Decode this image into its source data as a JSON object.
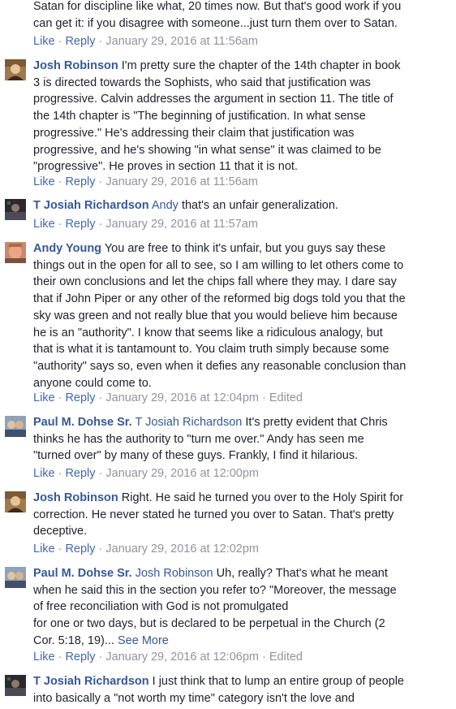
{
  "comments": [
    {
      "partial_top": true,
      "lines": [
        "Satan for discipline like what, 20 times now. But that's good work if you",
        "can get it: if you disagree with someone...just turn them over to Satan."
      ],
      "like": "Like",
      "reply": "Reply",
      "timestamp": "January 29, 2016 at 11:56am",
      "edited": ""
    },
    {
      "avatar": "avatar-josh",
      "author": "Josh Robinson",
      "mention": "",
      "first_line": "I'm pretty sure the chapter of the 14th chapter in book",
      "lines": [
        "3 is directed towards the Sophists, who said that justification was",
        "progressive. Calvin addresses the argument in section 11. The title of",
        "the 14th chapter is \"The beginning of justification. In what sense",
        "progressive.\" He's addressing their claim that justification was",
        "progressive, and he's showing \"in what sense\" it was claimed to be",
        "\"progressive\". He proves in section 11 that it is not."
      ],
      "like": "Like",
      "reply": "Reply",
      "timestamp": "January 29, 2016 at 11:56am",
      "edited": ""
    },
    {
      "avatar": "avatar-tjosiah",
      "author": "T Josiah Richardson",
      "mention": "Andy",
      "first_line": "that's an unfair generalization.",
      "lines": [],
      "like": "Like",
      "reply": "Reply",
      "timestamp": "January 29, 2016 at 11:57am",
      "edited": ""
    },
    {
      "avatar": "avatar-andy",
      "author": "Andy Young",
      "mention": "",
      "first_line": "You are free to think it's unfair, but you guys say these",
      "lines": [
        "things out in the open for all to see, so I am willing to let others come to",
        "their own conclusions and let the chips fall where they may. I dare say",
        "that if John Piper or any other of the reformed big dogs told you that the",
        "sky was green and not really blue that you would believe him because",
        "he is an \"authority\". I know that seems like a ridiculous analogy, but",
        "that is what it is tantamount to. You claim truth simply because some",
        "\"authority\" says so, even when it defies any reasonable conclusion than",
        "anyone could come to."
      ],
      "like": "Like",
      "reply": "Reply",
      "timestamp": "January 29, 2016 at 12:04pm",
      "edited": "Edited"
    },
    {
      "avatar": "avatar-paul",
      "author": "Paul M. Dohse Sr.",
      "mention": "T Josiah Richardson",
      "first_line": "It's pretty evident that Chris",
      "lines": [
        "thinks he has the authority to \"turn me over.\" Andy has seen me",
        "\"turned over\" by many of these guys. Frankly, I find it hilarious."
      ],
      "like": "Like",
      "reply": "Reply",
      "timestamp": "January 29, 2016 at 12:00pm",
      "edited": ""
    },
    {
      "avatar": "avatar-josh",
      "author": "Josh Robinson",
      "mention": "",
      "first_line": "Right. He said he turned you over to the Holy Spirit for",
      "lines": [
        "correction. He never stated he turned you over to Satan. That's pretty",
        "deceptive."
      ],
      "like": "Like",
      "reply": "Reply",
      "timestamp": "January 29, 2016 at 12:02pm",
      "edited": ""
    },
    {
      "avatar": "avatar-paul",
      "author": "Paul M. Dohse Sr.",
      "mention": "Josh Robinson",
      "first_line": "Uh, really? That's what he meant",
      "lines": [
        "when he said this in the section you refer to? \"Moreover, the message",
        "of free reconciliation with God is not promulgated",
        "for one or two days, but is declared to be perpetual in the Church (2",
        "Cor. 5:18, 19)..."
      ],
      "see_more": "See More",
      "like": "Like",
      "reply": "Reply",
      "timestamp": "January 29, 2016 at 12:06pm",
      "edited": "Edited"
    },
    {
      "avatar": "avatar-tjosiah",
      "author": "T Josiah Richardson",
      "mention": "",
      "first_line": "I just think that to lump an entire group of people",
      "lines": [
        "into basically a \"not worth my time\" category isn't the love and"
      ],
      "like": "",
      "reply": "",
      "timestamp": "",
      "edited": ""
    }
  ],
  "colors": {
    "link": "#365899",
    "action": "#4267b2",
    "meta": "#90949c",
    "text": "#1d2129"
  }
}
